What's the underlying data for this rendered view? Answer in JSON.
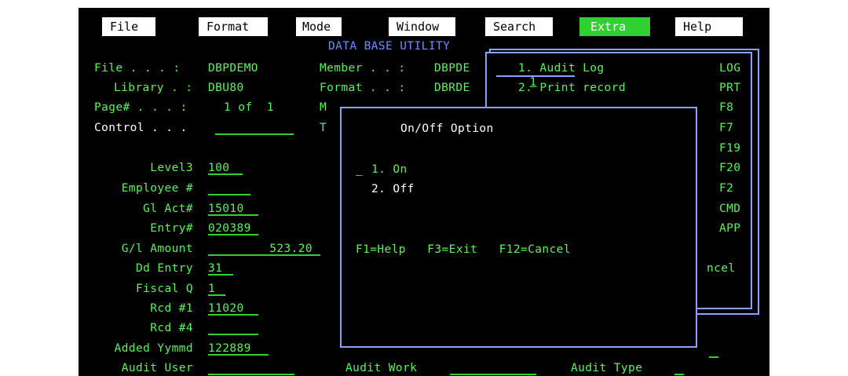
{
  "menu": [
    "File",
    "Format",
    "Mode",
    "Window",
    "Search",
    "Extra",
    "Help"
  ],
  "screen_title": "DATA BASE UTILITY",
  "header": {
    "file_label": "File . . . :",
    "file_value": "DBPDEMO",
    "library_label": "Library . :",
    "library_value": "DBU80",
    "page_label": "Page# . . . :",
    "page_value": "1 of  1",
    "control_label": "Control . . .",
    "member_label": "Member . . :",
    "member_value": "DBPDE",
    "format_label": "Format . . :",
    "format_value": "DBRDE",
    "m_letter": "M",
    "t_letter": "T"
  },
  "fields": [
    {
      "label": "Level3",
      "value": "100"
    },
    {
      "label": "Employee #",
      "value": ""
    },
    {
      "label": "Gl Act#",
      "value": "15010"
    },
    {
      "label": "Entry#",
      "value": "020389"
    },
    {
      "label": "G/l Amount",
      "value": "523.20"
    },
    {
      "label": "Dd Entry",
      "value": "31"
    },
    {
      "label": "Fiscal Q",
      "value": "1"
    },
    {
      "label": "Rcd #1",
      "value": "11020"
    },
    {
      "label": "Rcd #4",
      "value": ""
    },
    {
      "label": "Added Yymmd",
      "value": "122889"
    },
    {
      "label": "Audit User",
      "value": ""
    }
  ],
  "bottom": {
    "audit_work": "Audit Work",
    "audit_type": "Audit Type"
  },
  "extra_menu": {
    "selection": "1",
    "items": [
      {
        "label": "1. Audit Log",
        "key": "LOG"
      },
      {
        "label": "2. Print record",
        "key": "PRT"
      }
    ],
    "more_keys": [
      "F8",
      "F7",
      "F19",
      "F20",
      "F2",
      "CMD",
      "APP"
    ],
    "partial_cancel": "ncel"
  },
  "popup": {
    "title": "On/Off Option",
    "options": [
      "1. On",
      "2. Off"
    ],
    "fkeys": "F1=Help   F3=Exit   F12=Cancel"
  }
}
